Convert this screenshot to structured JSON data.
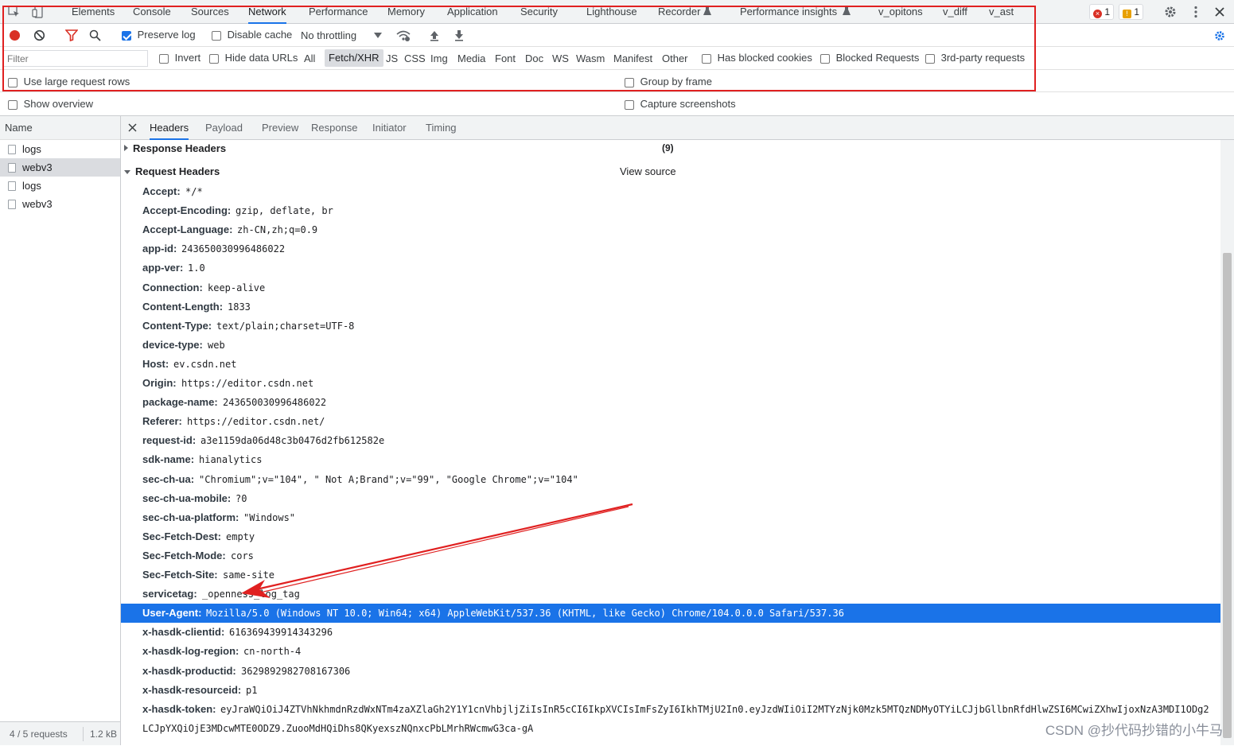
{
  "tabs": [
    "Elements",
    "Console",
    "Sources",
    "Network",
    "Performance",
    "Memory",
    "Application",
    "Security",
    "Lighthouse",
    "Recorder",
    "Performance insights",
    "v_opitons",
    "v_diff",
    "v_ast"
  ],
  "badges": {
    "errors": "1",
    "warnings": "1"
  },
  "toolbar": {
    "preserve_log": "Preserve log",
    "disable_cache": "Disable cache",
    "throttling": "No throttling"
  },
  "filterbar": {
    "placeholder": "Filter",
    "invert": "Invert",
    "hide_data_urls": "Hide data URLs",
    "types": [
      "All",
      "Fetch/XHR",
      "JS",
      "CSS",
      "Img",
      "Media",
      "Font",
      "Doc",
      "WS",
      "Wasm",
      "Manifest",
      "Other"
    ],
    "active_type": "Fetch/XHR",
    "blocked_cookies": "Has blocked cookies",
    "blocked_requests": "Blocked Requests",
    "third_party": "3rd-party requests"
  },
  "options": {
    "large_rows": "Use large request rows",
    "group_by_frame": "Group by frame",
    "show_overview": "Show overview",
    "capture_screenshots": "Capture screenshots"
  },
  "requests": {
    "header": "Name",
    "items": [
      "logs",
      "webv3",
      "logs",
      "webv3"
    ],
    "selected_index": 1,
    "status": "4 / 5 requests",
    "size": "1.2 kB"
  },
  "detail_tabs": [
    "Headers",
    "Payload",
    "Preview",
    "Response",
    "Initiator",
    "Timing"
  ],
  "response_headers": {
    "title": "Response Headers",
    "count": "(9)"
  },
  "request_headers": {
    "title": "Request Headers",
    "view_source": "View source",
    "items": [
      {
        "k": "Accept:",
        "v": "*/*"
      },
      {
        "k": "Accept-Encoding:",
        "v": "gzip, deflate, br"
      },
      {
        "k": "Accept-Language:",
        "v": "zh-CN,zh;q=0.9"
      },
      {
        "k": "app-id:",
        "v": "243650030996486022"
      },
      {
        "k": "app-ver:",
        "v": "1.0"
      },
      {
        "k": "Connection:",
        "v": "keep-alive"
      },
      {
        "k": "Content-Length:",
        "v": "1833"
      },
      {
        "k": "Content-Type:",
        "v": "text/plain;charset=UTF-8"
      },
      {
        "k": "device-type:",
        "v": "web"
      },
      {
        "k": "Host:",
        "v": "ev.csdn.net"
      },
      {
        "k": "Origin:",
        "v": "https://editor.csdn.net"
      },
      {
        "k": "package-name:",
        "v": "243650030996486022"
      },
      {
        "k": "Referer:",
        "v": "https://editor.csdn.net/"
      },
      {
        "k": "request-id:",
        "v": "a3e1159da06d48c3b0476d2fb612582e"
      },
      {
        "k": "sdk-name:",
        "v": "hianalytics"
      },
      {
        "k": "sec-ch-ua:",
        "v": "\"Chromium\";v=\"104\", \" Not A;Brand\";v=\"99\", \"Google Chrome\";v=\"104\""
      },
      {
        "k": "sec-ch-ua-mobile:",
        "v": "?0"
      },
      {
        "k": "sec-ch-ua-platform:",
        "v": "\"Windows\""
      },
      {
        "k": "Sec-Fetch-Dest:",
        "v": "empty"
      },
      {
        "k": "Sec-Fetch-Mode:",
        "v": "cors"
      },
      {
        "k": "Sec-Fetch-Site:",
        "v": "same-site"
      },
      {
        "k": "servicetag:",
        "v": "_openness_log_tag"
      },
      {
        "k": "User-Agent:",
        "v": "Mozilla/5.0 (Windows NT 10.0; Win64; x64) AppleWebKit/537.36 (KHTML, like Gecko) Chrome/104.0.0.0 Safari/537.36"
      },
      {
        "k": "x-hasdk-clientid:",
        "v": "616369439914343296"
      },
      {
        "k": "x-hasdk-log-region:",
        "v": "cn-north-4"
      },
      {
        "k": "x-hasdk-productid:",
        "v": "3629892982708167306"
      },
      {
        "k": "x-hasdk-resourceid:",
        "v": "p1"
      },
      {
        "k": "x-hasdk-token:",
        "v": "eyJraWQiOiJ4ZTVhNkhmdnRzdWxNTm4zaXZlaGh2Y1Y1cnVhbjljZiIsInR5cCI6IkpXVCIsImFsZyI6IkhTMjU2In0.eyJzdWIiOiI2MTYzNjk0Mzk5MTQzNDMyOTYiLCJjbGllbnRfdHlwZSI6MCwiZXhwIjoxNzA3MDI1ODg2"
      }
    ],
    "highlight_index": 22,
    "token_continuation": "LCJpYXQiOjE3MDcwMTE0ODZ9.ZuooMdHQiDhs8QKyexszNQnxcPbLMrhRWcmwG3ca-gA"
  },
  "watermark": "CSDN @抄代码抄错的小牛马",
  "colors": {
    "accent": "#1a73e8",
    "annotation": "#e02020"
  }
}
